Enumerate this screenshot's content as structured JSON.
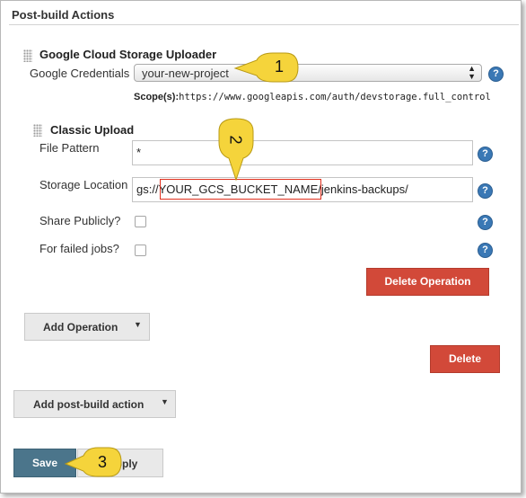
{
  "section": {
    "title": "Post-build Actions"
  },
  "gcs": {
    "title": "Google Cloud Storage Uploader",
    "credentials_label": "Google Credentials",
    "credentials_value": "your-new-project",
    "scope_label": "Scope(s):",
    "scope_value": "https://www.googleapis.com/auth/devstorage.full_control"
  },
  "classic": {
    "title": "Classic Upload",
    "file_pattern_label": "File Pattern",
    "file_pattern_value": "*",
    "storage_location_label": "Storage Location",
    "storage_prefix": "gs://",
    "bucket_name": "YOUR_GCS_BUCKET_NAME",
    "storage_suffix": "/jenkins-backups/",
    "share_publicly_label": "Share Publicly?",
    "share_publicly_checked": false,
    "failed_jobs_label": "For failed jobs?",
    "failed_jobs_checked": false,
    "delete_operation_label": "Delete Operation"
  },
  "add_operation_label": "Add Operation",
  "delete_label": "Delete",
  "add_post_build_label": "Add post-build action",
  "save_label": "Save",
  "apply_label": "Apply",
  "help_glyph": "?",
  "callouts": [
    "1",
    "2",
    "3"
  ],
  "colors": {
    "red_button": "#d24939",
    "blue_button": "#4b758b",
    "help_icon": "#3a78b5",
    "callout": "#f5d43b",
    "highlight_box": "#e0301e"
  }
}
